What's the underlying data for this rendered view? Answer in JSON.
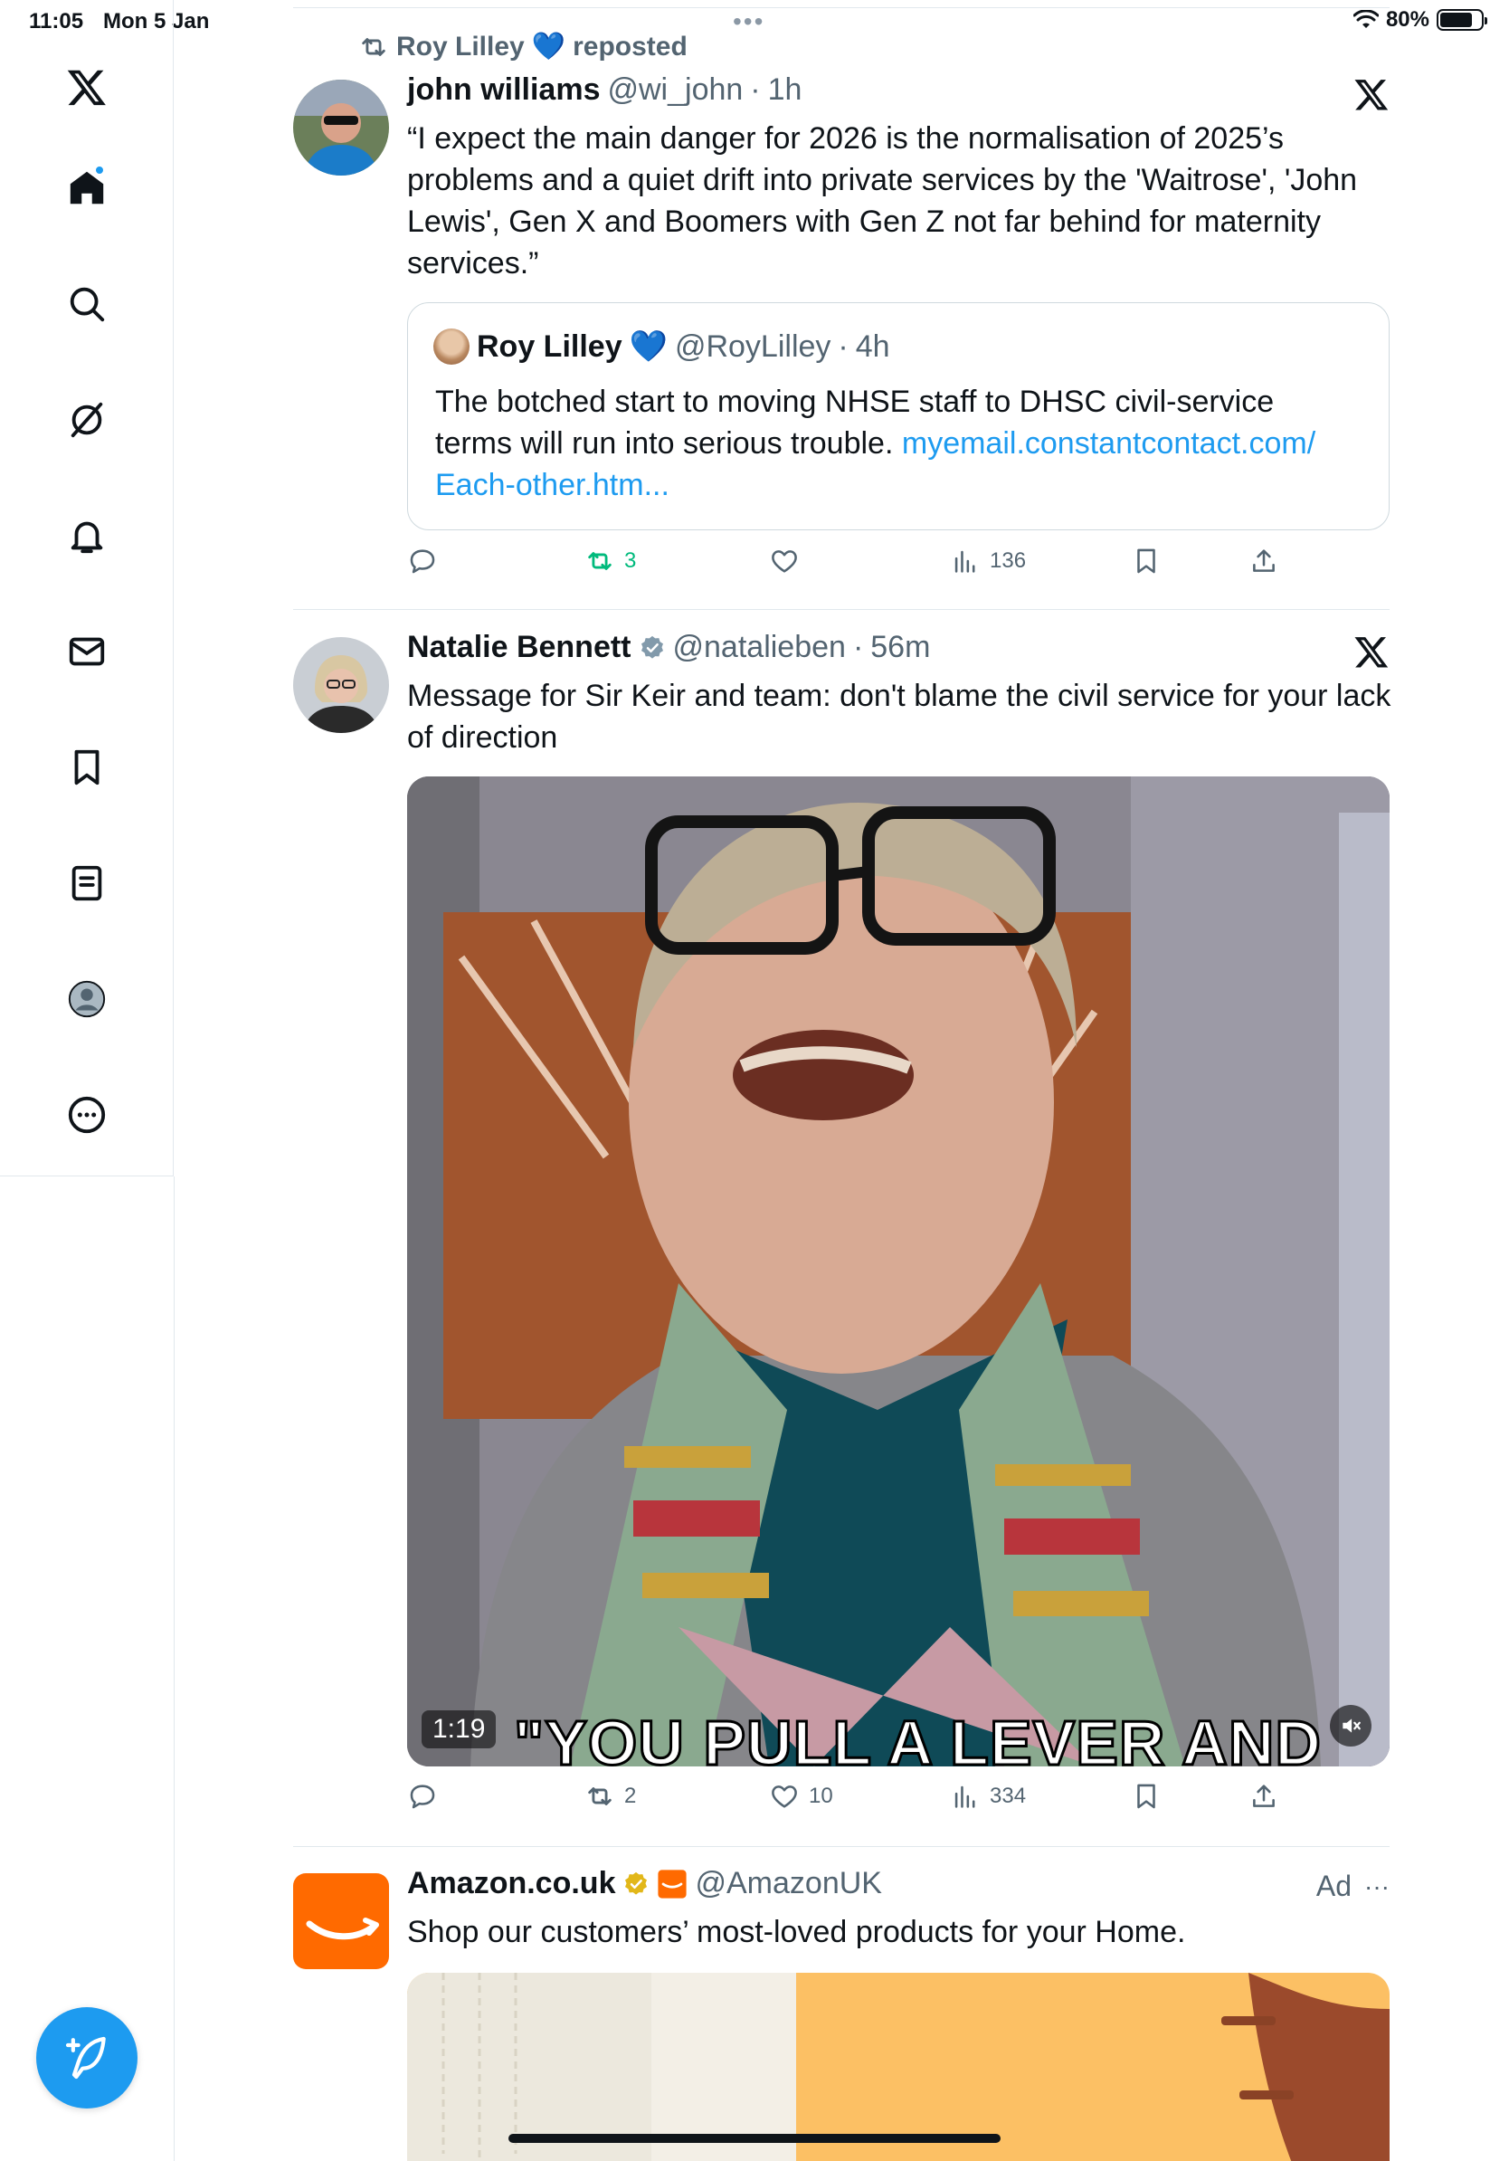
{
  "status_bar": {
    "time": "11:05",
    "date": "Mon 5 Jan",
    "battery_text": "80%",
    "battery_level": 0.8
  },
  "sidebar": {
    "items": [
      "x-logo",
      "home",
      "search",
      "grok",
      "notifications",
      "messages",
      "bookmarks",
      "lists",
      "profile",
      "more"
    ]
  },
  "tweets": [
    {
      "repost_by": "Roy Lilley",
      "repost_suffix": "reposted",
      "author_name": "john williams",
      "author_handle": "@wi_john",
      "sep": "·",
      "time": "1h",
      "text": "“I expect the main danger for 2026 is the normalisation of 2025’s problems and a quiet drift into private services by the 'Waitrose', 'John Lewis', Gen X and Boomers with Gen Z not far behind for maternity services.”",
      "quote": {
        "author_name": "Roy Lilley",
        "author_handle": "@RoyLilley",
        "sep": "·",
        "time": "4h",
        "text": "The botched start to moving NHSE staff to DHSC civil-service terms will run into serious trouble.",
        "link_text": "myemail.constantcontact.com/ Each-other.htm..."
      },
      "stats": {
        "replies": "",
        "reposts": "3",
        "likes": "",
        "views": "136"
      }
    },
    {
      "author_name": "Natalie Bennett",
      "author_handle": "@natalieben",
      "sep": "·",
      "time": "56m",
      "text": "Message for Sir Keir and team: don't blame the civil service for your lack of direction",
      "video": {
        "duration": "1:19",
        "caption": "\"YOU PULL A LEVER AND"
      },
      "stats": {
        "replies": "",
        "reposts": "2",
        "likes": "10",
        "views": "334"
      }
    },
    {
      "author_name": "Amazon.co.uk",
      "author_handle": "@AmazonUK",
      "ad_label": "Ad",
      "more": "···",
      "text": "Shop our customers’ most-loved products for your Home."
    }
  ],
  "colors": {
    "accent": "#1d9bf0",
    "repost_green": "#00ba7c",
    "amazon_orange": "#ff9900",
    "verified_gold": "#e2b719"
  }
}
